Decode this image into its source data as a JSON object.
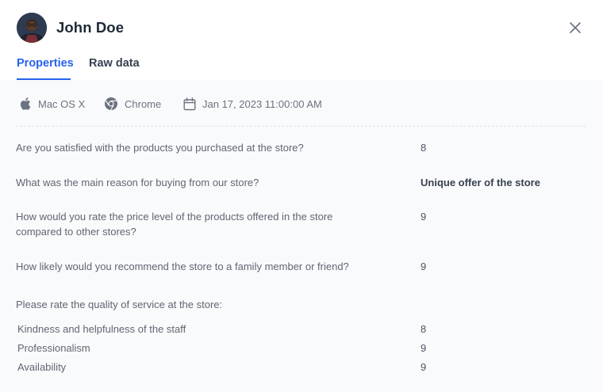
{
  "user": {
    "name": "John Doe"
  },
  "tabs": [
    {
      "label": "Properties",
      "active": true
    },
    {
      "label": "Raw data",
      "active": false
    }
  ],
  "meta": {
    "os": {
      "label": "Mac OS X",
      "icon": "apple-icon"
    },
    "browser": {
      "label": "Chrome",
      "icon": "chrome-icon"
    },
    "date": {
      "label": "Jan 17, 2023 11:00:00 AM",
      "icon": "calendar-icon"
    }
  },
  "responses": [
    {
      "question": "Are you satisfied with the products you purchased at the store?",
      "answer": "8"
    },
    {
      "question": "What was the main reason for buying from our store?",
      "answer": "Unique offer of the store"
    },
    {
      "question": "How would you rate the price level of the products offered in the store compared to other stores?",
      "answer": "9"
    },
    {
      "question": "How likely would you recommend the store to a family member or friend?",
      "answer": "9"
    }
  ],
  "rating_group": {
    "question": "Please rate the quality of service at the store:",
    "items": [
      {
        "label": "Kindness and helpfulness of the staff",
        "value": "8"
      },
      {
        "label": "Professionalism",
        "value": "9"
      },
      {
        "label": "Availability",
        "value": "9"
      }
    ]
  },
  "colors": {
    "accent": "#2563eb",
    "panel_background": "#f9fafb",
    "text": "#4b5563"
  }
}
